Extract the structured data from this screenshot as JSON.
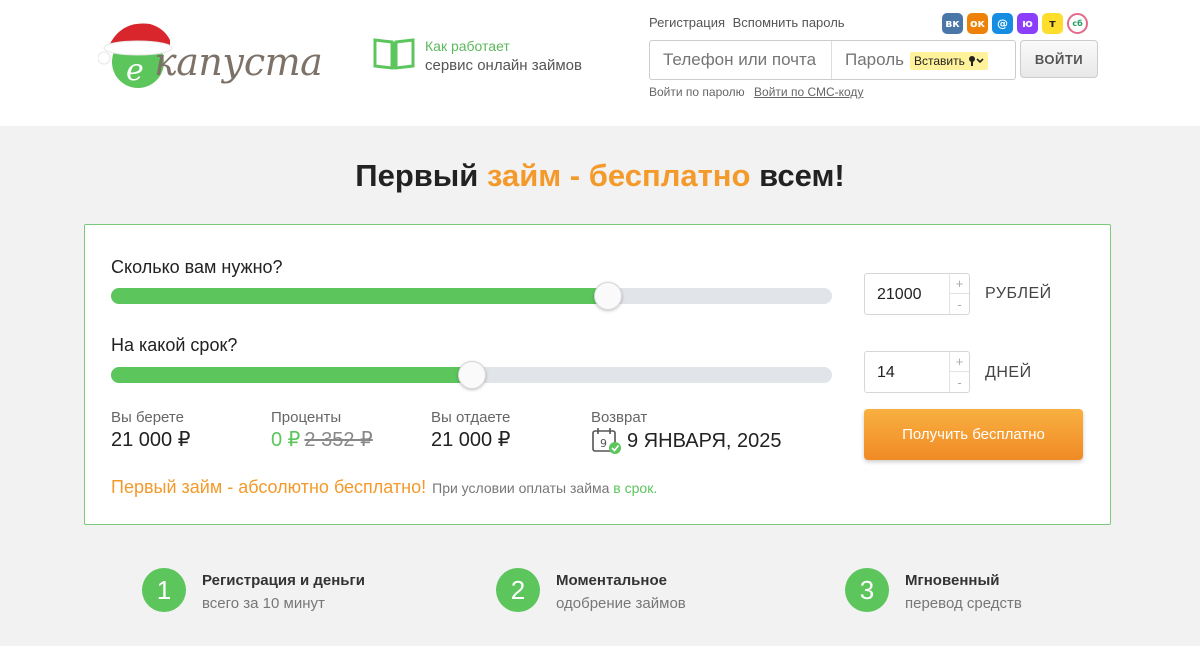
{
  "brand": {
    "logo_text": "капуста",
    "logo_letter": "е"
  },
  "how_it_works": {
    "title": "Как работает",
    "subtitle": "сервис онлайн займов"
  },
  "auth": {
    "register": "Регистрация",
    "remind_password": "Вспомнить пароль",
    "phone_placeholder": "Телефон или почта",
    "password_placeholder": "Пароль",
    "paste_label": "Вставить",
    "login_button": "ВОЙТИ",
    "by_password": "Войти по паролю",
    "by_sms": "Войти по СМС-коду"
  },
  "socials": [
    {
      "name": "vk-icon",
      "glyph": "вк",
      "color": "#4a76a8"
    },
    {
      "name": "odnoklassniki-icon",
      "glyph": "ок",
      "color": "#ee8208"
    },
    {
      "name": "mailru-icon",
      "glyph": "@",
      "color": "#168de2"
    },
    {
      "name": "yumoney-icon",
      "glyph": "ю",
      "color": "#8b3ffd"
    },
    {
      "name": "tbank-icon",
      "glyph": "т",
      "color": "#ffdd2d"
    },
    {
      "name": "sber-icon",
      "glyph": "сб",
      "color": "#ffffff"
    }
  ],
  "headline": {
    "part1": "Первый ",
    "highlight": "займ - бесплатно",
    "part2": " всем!"
  },
  "calculator": {
    "amount_question": "Сколько вам нужно?",
    "amount_value": "21000",
    "amount_unit": "РУБЛЕЙ",
    "amount_fraction": 0.69,
    "term_question": "На какой срок?",
    "term_value": "14",
    "term_unit": "ДНЕЙ",
    "term_fraction": 0.5,
    "plus": "+",
    "minus": "-",
    "take_label": "Вы берете",
    "take_value": "21 000 ₽",
    "interest_label": "Проценты",
    "interest_value": "0 ₽",
    "interest_old": "2 352 ₽",
    "give_label": "Вы отдаете",
    "give_value": "21 000 ₽",
    "return_label": "Возврат",
    "return_day_num": "9",
    "return_date": "9 ЯНВАРЯ, 2025",
    "cta": "Получить бесплатно",
    "promo_main": "Первый займ - абсолютно бесплатно!",
    "promo_note": "При условии оплаты займа",
    "promo_note_green": " в срок."
  },
  "steps": [
    {
      "num": "1",
      "title": "Регистрация и деньги",
      "sub": "всего за 10 минут"
    },
    {
      "num": "2",
      "title": "Моментальное",
      "sub": "одобрение займов"
    },
    {
      "num": "3",
      "title": "Мгновенный",
      "sub": "перевод средств"
    }
  ]
}
